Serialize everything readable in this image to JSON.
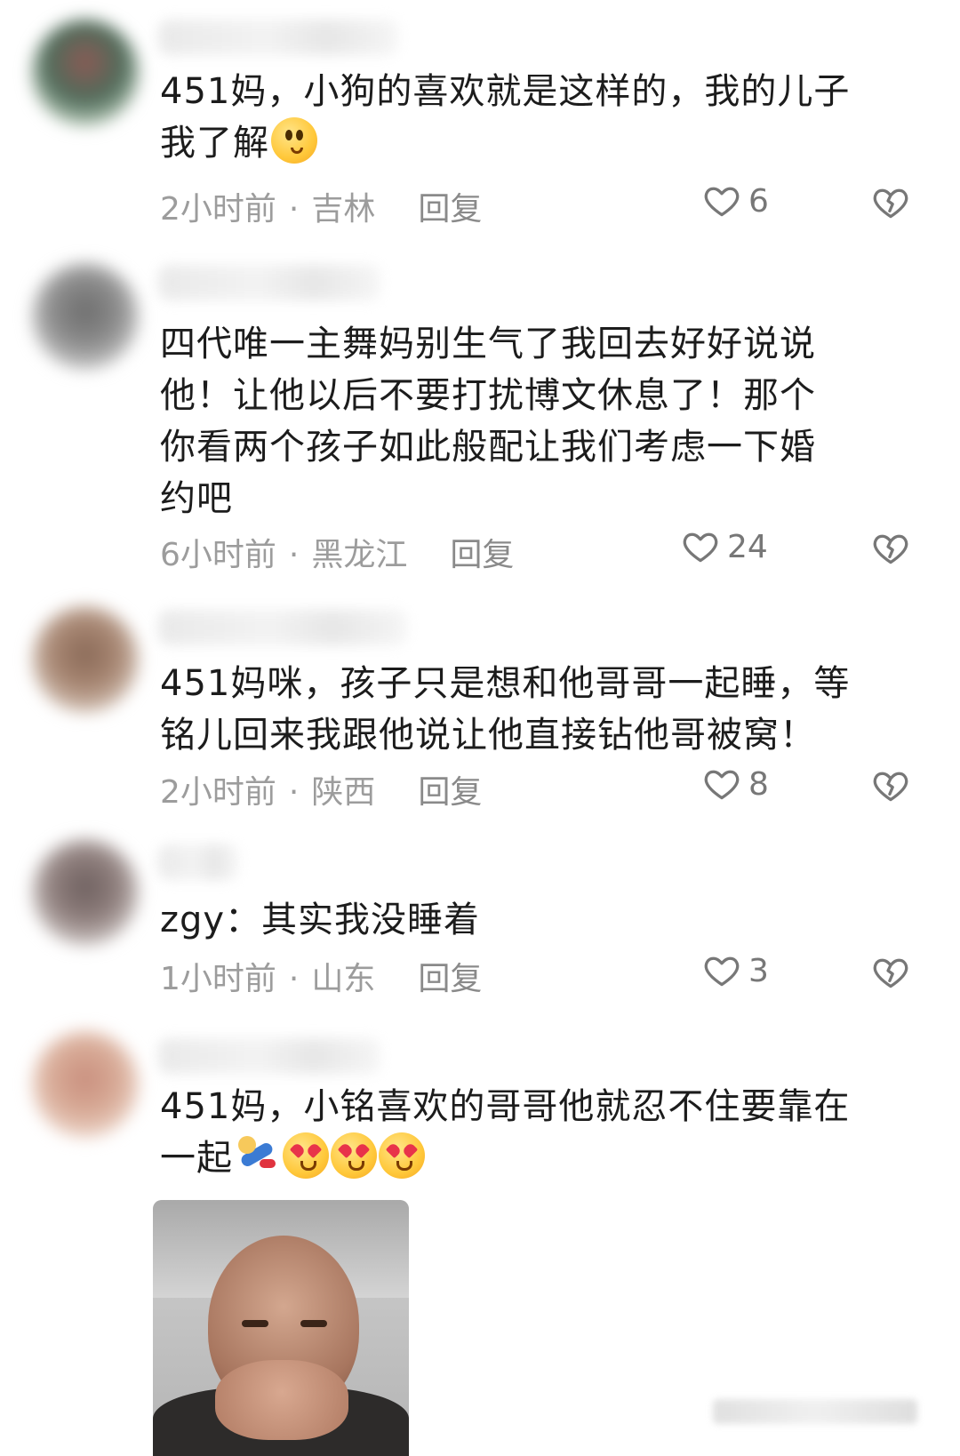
{
  "colors": {
    "text": "#1c1c1c",
    "meta": "#9c9c9c",
    "icon": "#777777"
  },
  "comments": [
    {
      "text": "451妈，小狗的喜欢就是这样的，我的儿子\n我了解",
      "emoji": [
        "thinking-face-emoji"
      ],
      "time": "2小时前",
      "location": "吉林",
      "reply_label": "回复",
      "likes": "6"
    },
    {
      "text": "四代唯一主舞妈别生气了我回去好好说说\n他！让他以后不要打扰博文休息了！那个\n你看两个孩子如此般配让我们考虑一下婚\n约吧",
      "time": "6小时前",
      "location": "黑龙江",
      "reply_label": "回复",
      "likes": "24"
    },
    {
      "text": "451妈咪，孩子只是想和他哥哥一起睡，等\n铭儿回来我跟他说让他直接钻他哥被窝！",
      "time": "2小时前",
      "location": "陕西",
      "reply_label": "回复",
      "likes": "8"
    },
    {
      "text": "zgy：其实我没睡着",
      "time": "1小时前",
      "location": "山东",
      "reply_label": "回复",
      "likes": "3"
    },
    {
      "text": "451妈，小铭喜欢的哥哥他就忍不住要靠在\n一起",
      "emoji": [
        "rushing-person-emoji",
        "heart-eyes-kiss-emoji",
        "heart-eyes-kiss-emoji",
        "heart-eyes-kiss-emoji"
      ],
      "sticker": "laughing-man-sticker"
    }
  ],
  "meta_separator": "·"
}
